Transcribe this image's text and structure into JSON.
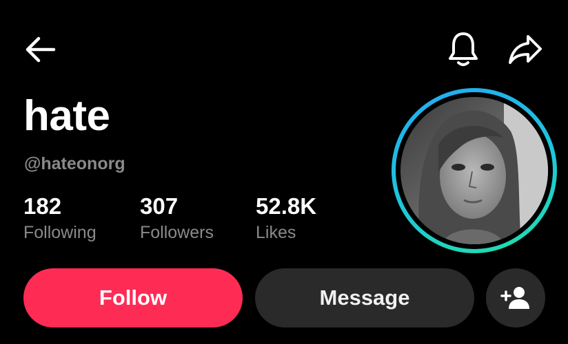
{
  "header": {
    "back_icon": "arrow-left-icon",
    "notification_icon": "bell-icon",
    "share_icon": "share-arrow-icon"
  },
  "profile": {
    "display_name": "hate",
    "username": "@hateonorg",
    "avatar_ring_colors": [
      "#25a8f2",
      "#21e0a8"
    ]
  },
  "stats": [
    {
      "value": "182",
      "label": "Following"
    },
    {
      "value": "307",
      "label": "Followers"
    },
    {
      "value": "52.8K",
      "label": "Likes"
    }
  ],
  "actions": {
    "follow_label": "Follow",
    "message_label": "Message",
    "add_friend_icon": "add-user-icon"
  },
  "colors": {
    "background": "#000000",
    "follow_button": "#fe2c55",
    "secondary_button": "#2a2a2a",
    "muted_text": "#8a8a8a"
  }
}
